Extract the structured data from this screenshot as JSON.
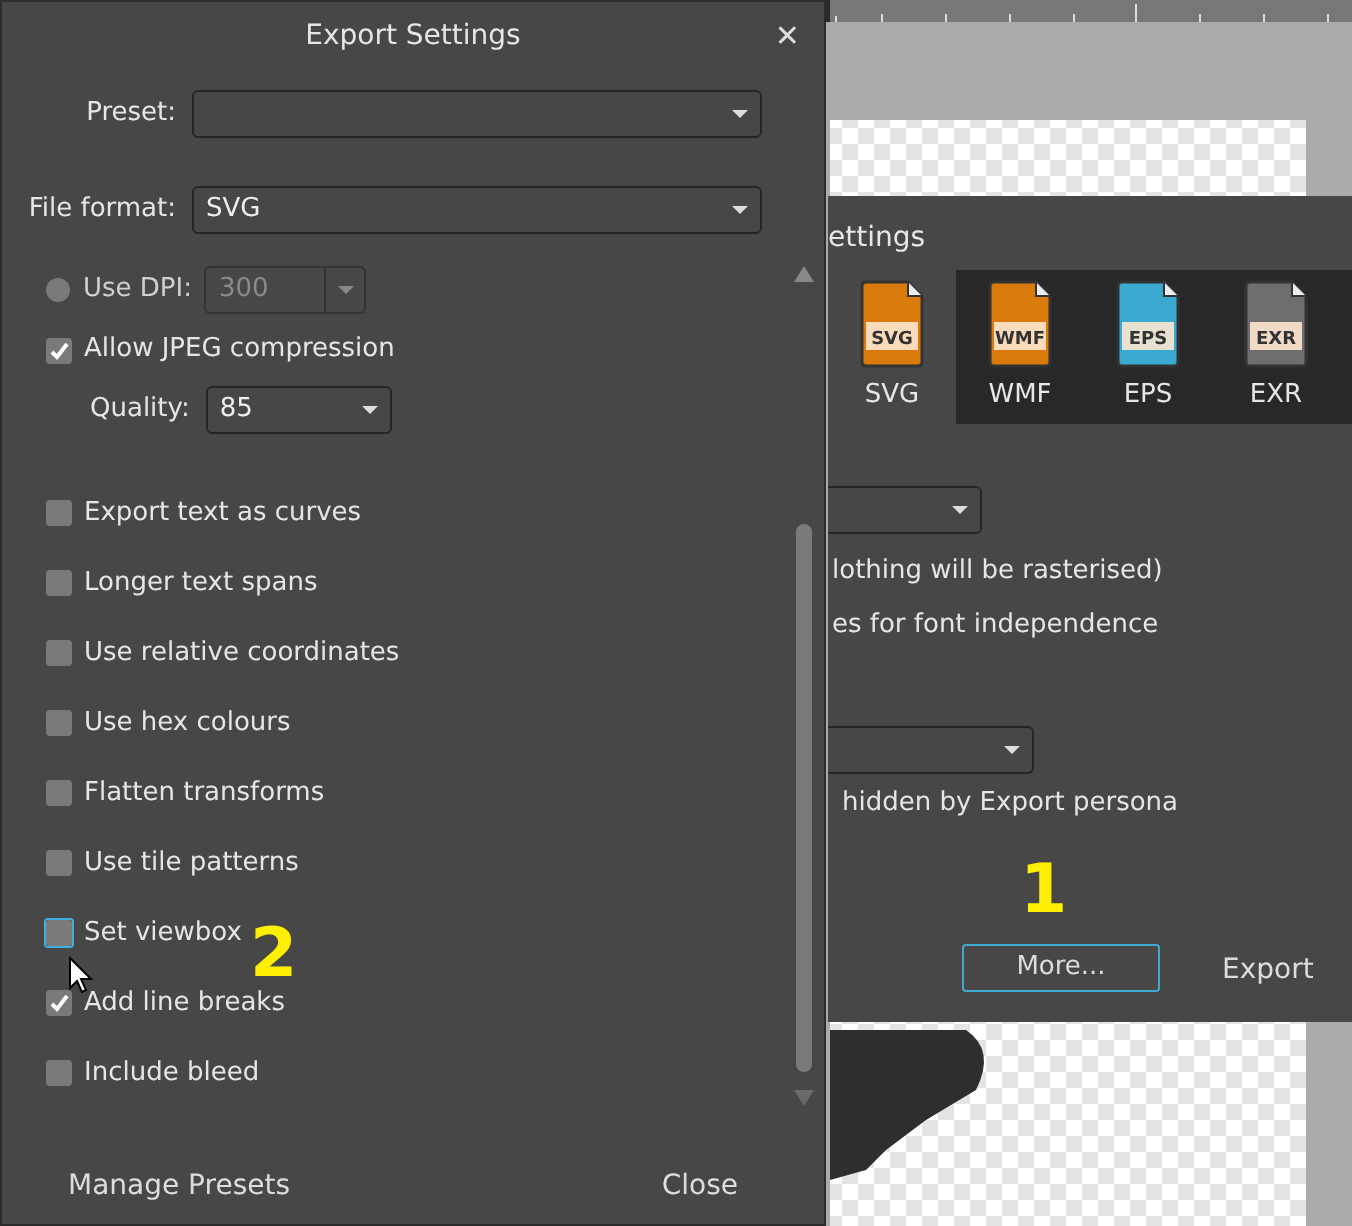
{
  "export_settings": {
    "title": "Export Settings",
    "close_glyph": "✕",
    "preset": {
      "label": "Preset:"
    },
    "file_format": {
      "label": "File format:",
      "value": "SVG"
    },
    "use_dpi": {
      "label": "Use DPI:",
      "selected": false,
      "disabled": true,
      "value": "300"
    },
    "allow_jpeg": {
      "label": "Allow JPEG compression",
      "checked": true
    },
    "quality": {
      "label": "Quality:",
      "value": "85"
    },
    "options": [
      {
        "label": "Export text as curves",
        "checked": false,
        "focused": false
      },
      {
        "label": "Longer text spans",
        "checked": false,
        "focused": false
      },
      {
        "label": "Use relative coordinates",
        "checked": false,
        "focused": false
      },
      {
        "label": "Use hex colours",
        "checked": false,
        "focused": false
      },
      {
        "label": "Flatten transforms",
        "checked": false,
        "focused": false
      },
      {
        "label": "Use tile patterns",
        "checked": false,
        "focused": false
      },
      {
        "label": "Set viewbox",
        "checked": false,
        "focused": true
      },
      {
        "label": "Add line breaks",
        "checked": true,
        "focused": false
      },
      {
        "label": "Include bleed",
        "checked": false,
        "focused": false
      }
    ],
    "buttons": [
      "Manage Presets",
      "Close"
    ]
  },
  "back_dialog": {
    "title": "ettings",
    "formats": [
      {
        "label": "SVG",
        "badge": "SVG",
        "color": "#d97a0a",
        "selected": true
      },
      {
        "label": "WMF",
        "badge": "WMF",
        "color": "#d97a0a",
        "selected": false
      },
      {
        "label": "EPS",
        "badge": "EPS",
        "color": "#3aa9cf",
        "selected": false
      },
      {
        "label": "EXR",
        "badge": "EXR",
        "color": "#6e6e6e",
        "selected": false
      }
    ],
    "texts": [
      "lothing will be rasterised)",
      "es for font independence",
      "hidden by Export persona"
    ],
    "more_button": "More...",
    "export_button": "Export"
  },
  "annotations": [
    "1",
    "2"
  ]
}
